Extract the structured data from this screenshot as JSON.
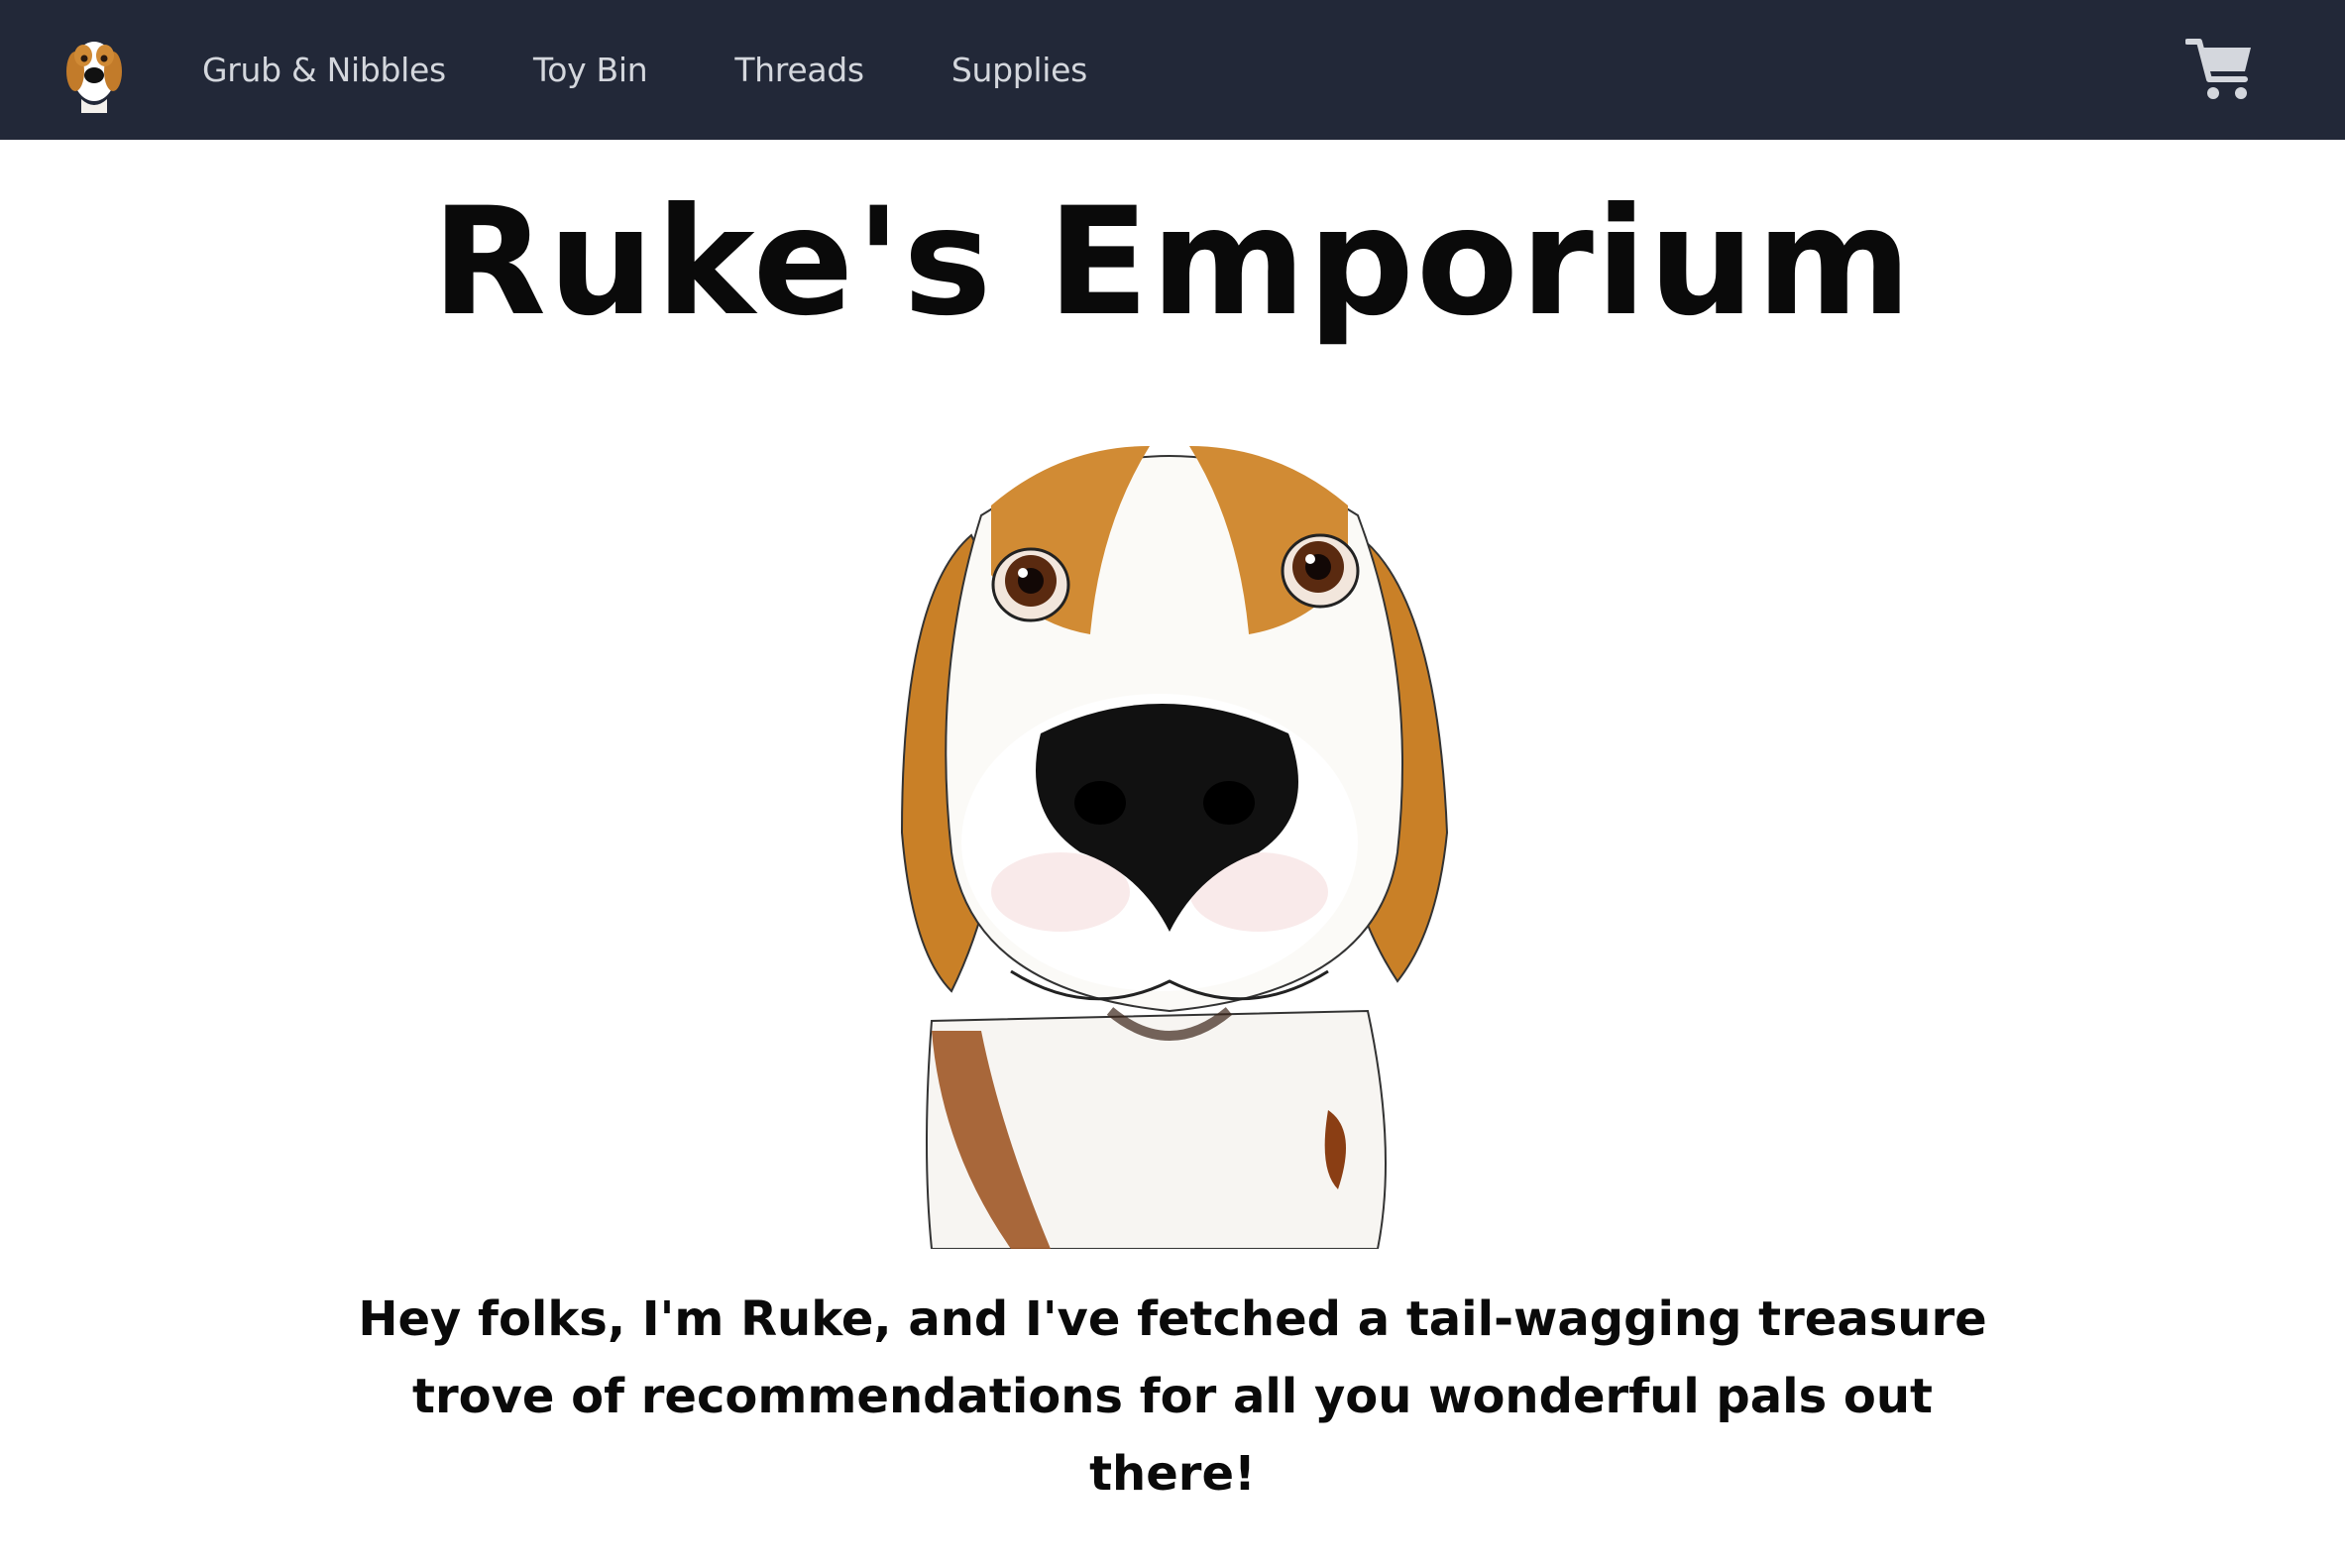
{
  "nav": {
    "logo_icon": "beagle-logo-icon",
    "links": [
      {
        "label": "Grub & Nibbles"
      },
      {
        "label": "Toy Bin"
      },
      {
        "label": "Threads"
      },
      {
        "label": "Supplies"
      }
    ],
    "cart_icon": "shopping-cart-icon",
    "background_color": "#222838",
    "link_color": "#d4d7dd"
  },
  "main": {
    "title": "Ruke's Emporium",
    "hero_image": "beagle-illustration",
    "intro_text": "Hey folks, I'm Ruke, and I've fetched a tail-wagging treasure trove of recommendations for all you wonderful pals out there!"
  }
}
